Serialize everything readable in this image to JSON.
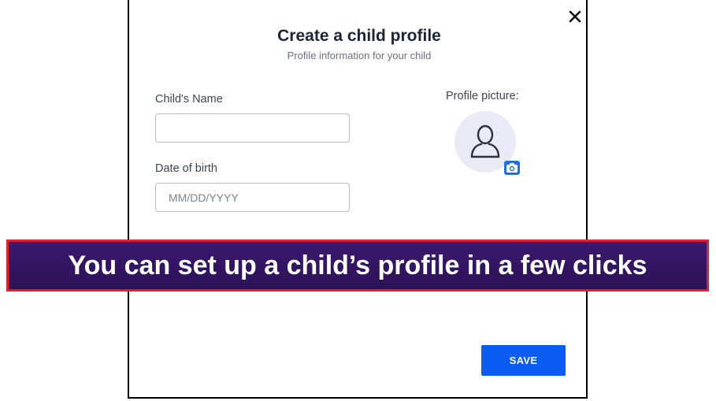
{
  "dialog": {
    "title": "Create a child profile",
    "subtitle": "Profile information for your child",
    "close_icon": "close-icon",
    "name_field": {
      "label": "Child's Name",
      "value": "",
      "placeholder": ""
    },
    "dob_field": {
      "label": "Date of birth",
      "value": "",
      "placeholder": "MM/DD/YYYY"
    },
    "profile_picture": {
      "label": "Profile picture:",
      "avatar_icon": "user-silhouette-icon",
      "camera_icon": "camera-icon"
    },
    "save_label": "SAVE"
  },
  "banner": {
    "text": "You can set up a child’s profile in a few clicks"
  },
  "colors": {
    "primary_button": "#0a5cf5",
    "banner_background": "#2c1157",
    "banner_border": "#e0202f",
    "avatar_background": "#e8ebf5"
  }
}
